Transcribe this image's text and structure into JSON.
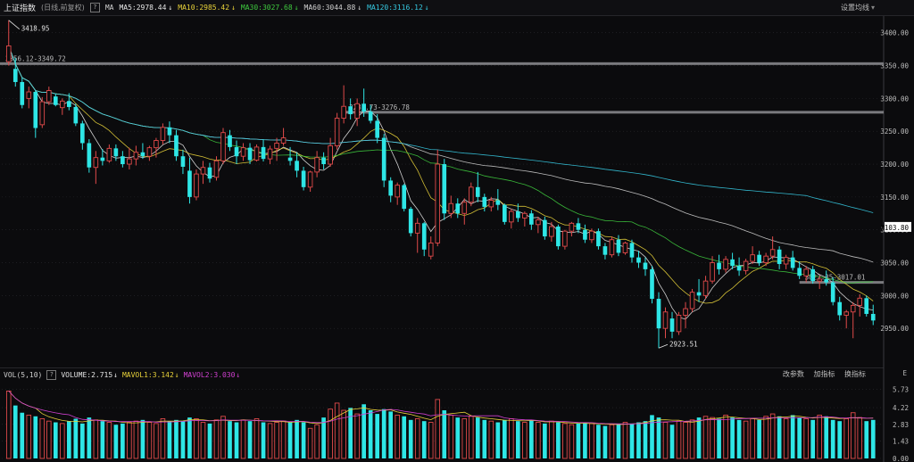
{
  "header": {
    "title": "上证指数",
    "subtitle": "(日线,前复权)",
    "help_icon": "?",
    "ma_label": "MA",
    "ma_items": [
      {
        "label": "MA5:2978.44",
        "dir": "↓",
        "color": "#e6e6e6"
      },
      {
        "label": "MA10:2985.42",
        "dir": "↓",
        "color": "#e8d23a"
      },
      {
        "label": "MA30:3027.68",
        "dir": "↓",
        "color": "#3ec93e"
      },
      {
        "label": "MA60:3044.88",
        "dir": "↓",
        "color": "#d0d0d0"
      },
      {
        "label": "MA120:3116.12",
        "dir": "↓",
        "color": "#36c8e0"
      }
    ],
    "settings_label": "设置均线"
  },
  "volume_header": {
    "label": "VOL(5,10)",
    "help_icon": "?",
    "items": [
      {
        "label": "VOLUME:2.715",
        "dir": "↓",
        "color": "#e6e6e6"
      },
      {
        "label": "MAVOL1:3.142",
        "dir": "↓",
        "color": "#e8d23a"
      },
      {
        "label": "MAVOL2:3.030",
        "dir": "↓",
        "color": "#d040d0"
      }
    ],
    "buttons": [
      "改参数",
      "加指标",
      "换指标"
    ]
  },
  "colors": {
    "up": "#e04a4a",
    "down": "#2ee6e6",
    "bg": "#0b0b0d",
    "ma5": "#e6e6e6",
    "ma10": "#e8d23a",
    "ma30": "#3ec93e",
    "ma60": "#d0d0d0",
    "ma120": "#36c8e0",
    "mavol1": "#e8d23a",
    "mavol2": "#d040d0",
    "grid": "#2b2b2f",
    "hline": "#8a8a8a"
  },
  "chart_data": {
    "type": "candlestick",
    "price_axis": {
      "ylim": [
        2900,
        3420
      ],
      "ticks": [
        "3400.00",
        "3350.00",
        "3300.00",
        "3250.00",
        "3200.00",
        "3150.00",
        "3100.00",
        "3050.00",
        "3000.00",
        "2950.00"
      ],
      "current_label": "3103.80"
    },
    "volume_axis": {
      "ylim": [
        0,
        6.3
      ],
      "ticks": [
        "5.73",
        "4.22",
        "2.83",
        "1.43",
        "0.00"
      ],
      "unit_label": "E"
    },
    "annotations": {
      "high_label": "3418.95",
      "low_label": "2923.51",
      "hlines": [
        {
          "label": "3356.12-3349.72",
          "value": 3353
        },
        {
          "label": "3281.73-3276.78",
          "value": 3279
        },
        {
          "label": "3022.35-3017.01",
          "value": 3020
        }
      ]
    },
    "candles": [
      [
        3356,
        3419,
        3350,
        3380
      ],
      [
        3345,
        3362,
        3318,
        3325
      ],
      [
        3325,
        3332,
        3285,
        3290
      ],
      [
        3300,
        3318,
        3285,
        3310
      ],
      [
        3310,
        3312,
        3240,
        3255
      ],
      [
        3260,
        3302,
        3255,
        3295
      ],
      [
        3295,
        3318,
        3290,
        3312
      ],
      [
        3303,
        3307,
        3288,
        3290
      ],
      [
        3286,
        3300,
        3275,
        3296
      ],
      [
        3296,
        3308,
        3282,
        3287
      ],
      [
        3287,
        3292,
        3258,
        3262
      ],
      [
        3262,
        3266,
        3222,
        3232
      ],
      [
        3232,
        3238,
        3187,
        3195
      ],
      [
        3195,
        3220,
        3170,
        3210
      ],
      [
        3210,
        3223,
        3198,
        3205
      ],
      [
        3205,
        3230,
        3202,
        3224
      ],
      [
        3224,
        3230,
        3205,
        3212
      ],
      [
        3212,
        3220,
        3195,
        3200
      ],
      [
        3200,
        3225,
        3192,
        3208
      ],
      [
        3208,
        3228,
        3198,
        3218
      ],
      [
        3218,
        3232,
        3208,
        3212
      ],
      [
        3212,
        3228,
        3205,
        3225
      ],
      [
        3225,
        3240,
        3210,
        3236
      ],
      [
        3236,
        3262,
        3230,
        3256
      ],
      [
        3256,
        3265,
        3232,
        3244
      ],
      [
        3244,
        3252,
        3205,
        3212
      ],
      [
        3212,
        3222,
        3185,
        3196
      ],
      [
        3190,
        3210,
        3140,
        3150
      ],
      [
        3150,
        3192,
        3145,
        3185
      ],
      [
        3185,
        3205,
        3170,
        3195
      ],
      [
        3195,
        3202,
        3172,
        3178
      ],
      [
        3180,
        3212,
        3175,
        3205
      ],
      [
        3205,
        3255,
        3200,
        3248
      ],
      [
        3244,
        3252,
        3220,
        3226
      ],
      [
        3226,
        3236,
        3200,
        3212
      ],
      [
        3212,
        3232,
        3205,
        3225
      ],
      [
        3225,
        3232,
        3200,
        3206
      ],
      [
        3206,
        3230,
        3204,
        3226
      ],
      [
        3226,
        3238,
        3204,
        3208
      ],
      [
        3208,
        3228,
        3200,
        3223
      ],
      [
        3224,
        3240,
        3205,
        3232
      ],
      [
        3232,
        3255,
        3228,
        3240
      ],
      [
        3210,
        3226,
        3198,
        3205
      ],
      [
        3205,
        3218,
        3180,
        3190
      ],
      [
        3190,
        3196,
        3160,
        3165
      ],
      [
        3165,
        3190,
        3158,
        3188
      ],
      [
        3188,
        3220,
        3180,
        3210
      ],
      [
        3210,
        3218,
        3192,
        3200
      ],
      [
        3200,
        3240,
        3196,
        3228
      ],
      [
        3228,
        3278,
        3222,
        3270
      ],
      [
        3270,
        3320,
        3262,
        3288
      ],
      [
        3288,
        3300,
        3268,
        3276
      ],
      [
        3270,
        3300,
        3258,
        3292
      ],
      [
        3292,
        3315,
        3272,
        3280
      ],
      [
        3280,
        3290,
        3262,
        3266
      ],
      [
        3266,
        3276,
        3232,
        3240
      ],
      [
        3240,
        3246,
        3165,
        3175
      ],
      [
        3175,
        3180,
        3142,
        3152
      ],
      [
        3150,
        3172,
        3138,
        3168
      ],
      [
        3168,
        3170,
        3128,
        3132
      ],
      [
        3132,
        3135,
        3090,
        3095
      ],
      [
        3095,
        3118,
        3065,
        3110
      ],
      [
        3110,
        3112,
        3060,
        3070
      ],
      [
        3060,
        3090,
        3055,
        3080
      ],
      [
        3080,
        3222,
        3075,
        3200
      ],
      [
        3200,
        3208,
        3115,
        3125
      ],
      [
        3125,
        3152,
        3118,
        3140
      ],
      [
        3140,
        3148,
        3118,
        3125
      ],
      [
        3125,
        3148,
        3108,
        3142
      ],
      [
        3142,
        3172,
        3136,
        3165
      ],
      [
        3165,
        3188,
        3142,
        3150
      ],
      [
        3150,
        3155,
        3128,
        3135
      ],
      [
        3135,
        3150,
        3128,
        3145
      ],
      [
        3145,
        3162,
        3130,
        3138
      ],
      [
        3138,
        3140,
        3108,
        3112
      ],
      [
        3112,
        3132,
        3102,
        3128
      ],
      [
        3128,
        3140,
        3112,
        3118
      ],
      [
        3118,
        3128,
        3105,
        3125
      ],
      [
        3125,
        3130,
        3100,
        3108
      ],
      [
        3108,
        3120,
        3095,
        3115
      ],
      [
        3115,
        3120,
        3085,
        3090
      ],
      [
        3090,
        3112,
        3082,
        3105
      ],
      [
        3105,
        3108,
        3070,
        3075
      ],
      [
        3075,
        3100,
        3070,
        3098
      ],
      [
        3098,
        3112,
        3090,
        3110
      ],
      [
        3110,
        3118,
        3095,
        3100
      ],
      [
        3100,
        3108,
        3080,
        3085
      ],
      [
        3085,
        3102,
        3080,
        3098
      ],
      [
        3098,
        3102,
        3070,
        3075
      ],
      [
        3075,
        3080,
        3055,
        3062
      ],
      [
        3062,
        3090,
        3058,
        3085
      ],
      [
        3085,
        3092,
        3060,
        3065
      ],
      [
        3065,
        3082,
        3062,
        3080
      ],
      [
        3080,
        3085,
        3050,
        3058
      ],
      [
        3058,
        3068,
        3042,
        3050
      ],
      [
        3050,
        3058,
        3030,
        3040
      ],
      [
        3040,
        3045,
        2988,
        2995
      ],
      [
        2995,
        3005,
        2920,
        2950
      ],
      [
        2950,
        2982,
        2935,
        2975
      ],
      [
        2965,
        2975,
        2935,
        2945
      ],
      [
        2945,
        2975,
        2940,
        2970
      ],
      [
        2970,
        2990,
        2950,
        2980
      ],
      [
        2980,
        3010,
        2975,
        3005
      ],
      [
        3005,
        3025,
        2990,
        3000
      ],
      [
        3000,
        3030,
        2995,
        3022
      ],
      [
        3022,
        3060,
        3018,
        3050
      ],
      [
        3050,
        3062,
        3032,
        3040
      ],
      [
        3040,
        3060,
        3035,
        3055
      ],
      [
        3055,
        3065,
        3040,
        3045
      ],
      [
        3045,
        3058,
        3030,
        3038
      ],
      [
        3038,
        3056,
        3032,
        3052
      ],
      [
        3052,
        3075,
        3048,
        3062
      ],
      [
        3062,
        3068,
        3045,
        3050
      ],
      [
        3050,
        3065,
        3045,
        3060
      ],
      [
        3060,
        3090,
        3055,
        3070
      ],
      [
        3070,
        3075,
        3040,
        3048
      ],
      [
        3048,
        3062,
        3040,
        3058
      ],
      [
        3058,
        3068,
        3038,
        3042
      ],
      [
        3042,
        3052,
        3025,
        3030
      ],
      [
        3030,
        3045,
        3020,
        3040
      ],
      [
        3040,
        3045,
        3018,
        3022
      ],
      [
        3022,
        3030,
        3010,
        3025
      ],
      [
        3025,
        3038,
        3015,
        3020
      ],
      [
        3020,
        3028,
        2985,
        2990
      ],
      [
        2990,
        2998,
        2962,
        2970
      ],
      [
        2970,
        2978,
        2950,
        2975
      ],
      [
        2975,
        2990,
        2935,
        2985
      ],
      [
        2985,
        3002,
        2968,
        2996
      ],
      [
        2996,
        3000,
        2968,
        2972
      ],
      [
        2972,
        2986,
        2955,
        2962
      ]
    ],
    "volumes": [
      5.6,
      4.4,
      3.8,
      3.6,
      3.5,
      3.3,
      3.1,
      3.0,
      2.9,
      3.1,
      3.3,
      2.9,
      3.4,
      3.2,
      3.1,
      3.0,
      2.8,
      2.9,
      3.0,
      3.1,
      3.2,
      3.0,
      2.9,
      3.3,
      3.1,
      3.2,
      3.1,
      3.4,
      3.3,
      3.0,
      2.9,
      3.2,
      3.5,
      3.1,
      3.0,
      3.2,
      3.1,
      3.3,
      3.0,
      2.9,
      3.0,
      3.1,
      3.0,
      3.2,
      3.0,
      2.5,
      2.8,
      3.4,
      4.1,
      4.6,
      4.0,
      4.2,
      3.7,
      4.5,
      4.0,
      3.7,
      4.1,
      3.9,
      3.6,
      3.5,
      3.2,
      3.3,
      3.1,
      3.0,
      4.9,
      4.0,
      3.6,
      3.4,
      3.3,
      3.5,
      3.4,
      3.2,
      3.1,
      3.0,
      3.2,
      3.3,
      3.1,
      3.0,
      3.2,
      3.0,
      2.9,
      3.1,
      3.0,
      2.9,
      2.8,
      2.9,
      3.0,
      2.9,
      2.8,
      2.7,
      2.8,
      2.9,
      3.0,
      2.9,
      3.0,
      3.1,
      3.6,
      3.4,
      3.0,
      2.8,
      3.1,
      3.0,
      3.2,
      3.4,
      3.5,
      3.4,
      3.3,
      3.6,
      3.4,
      3.2,
      3.1,
      3.3,
      3.2,
      3.5,
      3.7,
      3.5,
      3.3,
      3.6,
      3.4,
      3.3,
      3.2,
      3.6,
      3.5,
      3.2,
      3.1,
      3.3,
      3.8,
      3.4,
      3.1,
      3.2
    ]
  }
}
